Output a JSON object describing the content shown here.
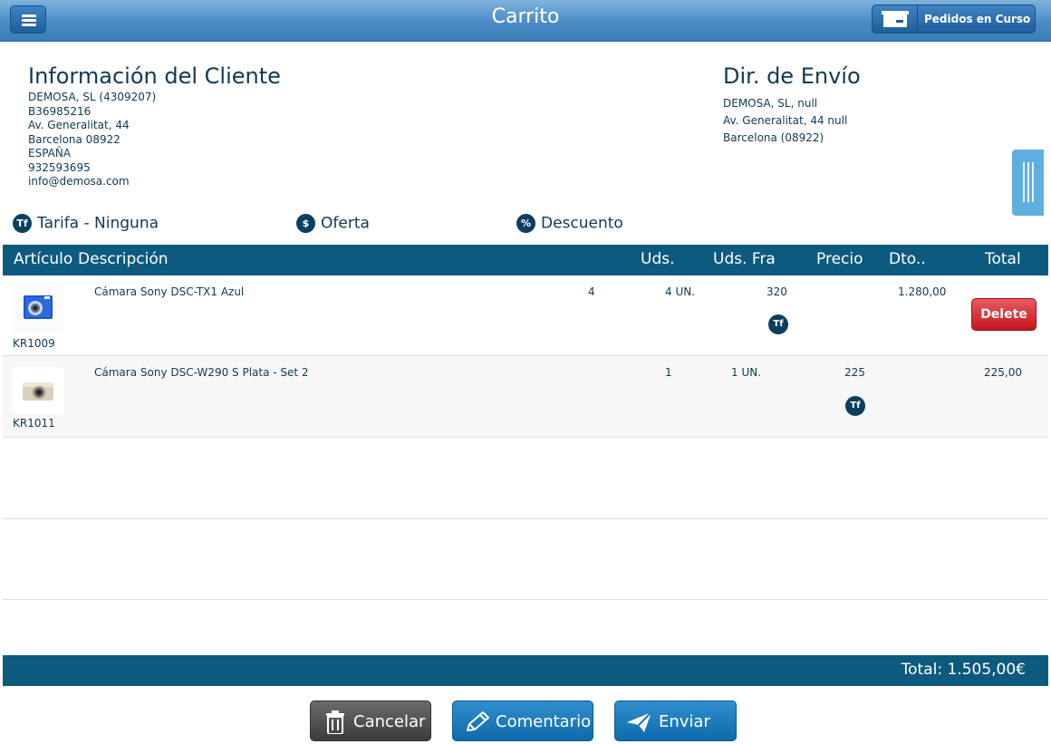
{
  "header": {
    "title": "Carrito",
    "orders_button": "Pedidos en Curso"
  },
  "customer": {
    "title": "Información del Cliente",
    "lines": [
      "DEMOSA, SL (4309207)",
      "B36985216",
      "Av. Generalitat, 44",
      "Barcelona 08922",
      "ESPAÑA",
      "932593695",
      "info@demosa.com"
    ]
  },
  "shipping": {
    "title": "Dir. de Envío",
    "lines": [
      "DEMOSA, SL, null",
      "Av. Generalitat, 44 null",
      "Barcelona (08922)"
    ]
  },
  "options": {
    "tariff": "Tarifa - Ninguna",
    "offer": "Oferta",
    "discount": "Descuento",
    "tariff_badge": "Tf",
    "offer_badge": "$",
    "discount_badge": "%"
  },
  "table": {
    "headers": {
      "article": "Artículo",
      "description": "Descripción",
      "units": "Uds.",
      "units_fra": "Uds. Fra",
      "price": "Precio",
      "discount": "Dto..",
      "total": "Total"
    },
    "rows": [
      {
        "code": "KR1009",
        "description": "Cámara Sony DSC-TX1 Azul",
        "units": "4",
        "units_fra": "4 UN.",
        "price": "320",
        "total": "1.280,00",
        "delete_label": "Delete",
        "badge": "Tf"
      },
      {
        "code": "KR1011",
        "description": "Cámara Sony DSC-W290 S Plata - Set 2",
        "units": "1",
        "units_fra": "1 UN.",
        "price": "225",
        "total": "225,00",
        "badge": "Tf"
      }
    ]
  },
  "footer": {
    "total": "Total: 1.505,00€"
  },
  "actions": {
    "cancel": "Cancelar",
    "comment": "Comentario",
    "send": "Enviar"
  },
  "colors": {
    "header_bar": "#4a8cc6",
    "table_header": "#0d5a7f",
    "delete_button": "#d32f2f",
    "cancel_button": "#4a4a4a",
    "action_button": "#1478b8"
  }
}
